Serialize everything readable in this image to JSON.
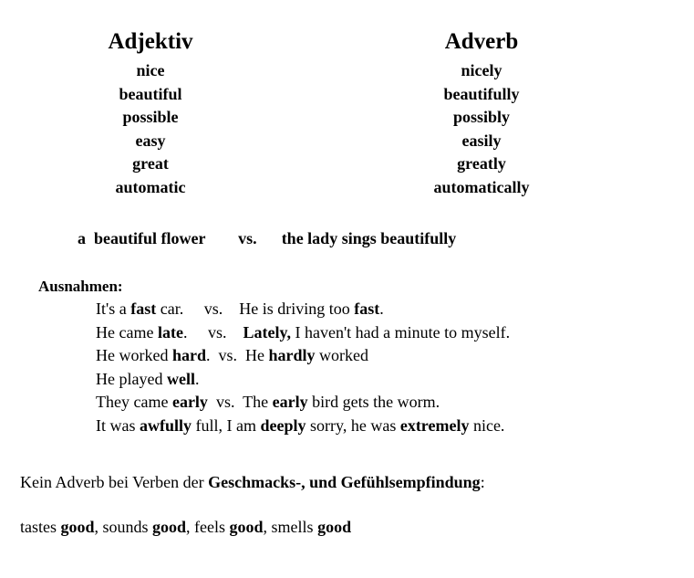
{
  "document": {
    "background_color": "#ffffff",
    "text_color": "#000000"
  },
  "word_table": {
    "headers": {
      "adjective": "Adjektiv",
      "adverb": "Adverb"
    },
    "pairs": [
      {
        "adjective": "nice",
        "adverb": "nicely"
      },
      {
        "adjective": "beautiful",
        "adverb": "beautifully"
      },
      {
        "adjective": "possible",
        "adverb": "possibly"
      },
      {
        "adjective": "easy",
        "adverb": "easily"
      },
      {
        "adjective": "great",
        "adverb": "greatly"
      },
      {
        "adjective": "automatic",
        "adverb": "automatically"
      }
    ]
  },
  "main_example": {
    "left": "a  beautiful flower",
    "separator": "vs.",
    "right": "the lady sings beautifully",
    "gap_left": "        ",
    "gap_right": "      "
  },
  "exceptions": {
    "title": "Ausnahmen:",
    "lines": [
      {
        "left_pre": "It's a ",
        "left_bold": "fast",
        "left_post": " car.",
        "sep_gap": "     ",
        "separator": "vs.",
        "sep_gap2": "    ",
        "right_pre": "He is driving too ",
        "right_bold": "fast",
        "right_post": "."
      },
      {
        "left_pre": "He came ",
        "left_bold": "late",
        "left_post": ".",
        "sep_gap": "     ",
        "separator": "vs.",
        "sep_gap2": "    ",
        "right_pre": "",
        "right_bold": "Lately,",
        "right_post": " I haven't had a minute to myself."
      },
      {
        "left_pre": "He worked ",
        "left_bold": "hard",
        "left_post": ".",
        "sep_gap": "  ",
        "separator": "vs.",
        "sep_gap2": "  ",
        "right_pre": "He ",
        "right_bold": "hardly",
        "right_post": " worked"
      },
      {
        "left_pre": "He played ",
        "left_bold": "well",
        "left_post": ".",
        "sep_gap": "",
        "separator": "",
        "sep_gap2": "",
        "right_pre": "",
        "right_bold": "",
        "right_post": ""
      },
      {
        "left_pre": "They came ",
        "left_bold": "early",
        "left_post": "",
        "sep_gap": "  ",
        "separator": "vs.",
        "sep_gap2": "  ",
        "right_pre": "The ",
        "right_bold": "early",
        "right_post": " bird gets the worm."
      }
    ],
    "adverb_intensifier_line": {
      "seg1": "It was ",
      "bold1": "awfully",
      "seg2": " full, I am ",
      "bold2": "deeply",
      "seg3": " sorry, he was ",
      "bold3": "extremely",
      "seg4": " nice."
    }
  },
  "note": {
    "prefix": "Kein Adverb bei Verben der ",
    "bold": "Geschmacks-, und Gefühlsempfindung",
    "suffix": ":"
  },
  "final_line": {
    "seg1": "tastes ",
    "bold1": "good",
    "seg2": ", sounds ",
    "bold2": "good",
    "seg3": ", feels ",
    "bold3": "good",
    "seg4": ", smells ",
    "bold4": "good"
  }
}
